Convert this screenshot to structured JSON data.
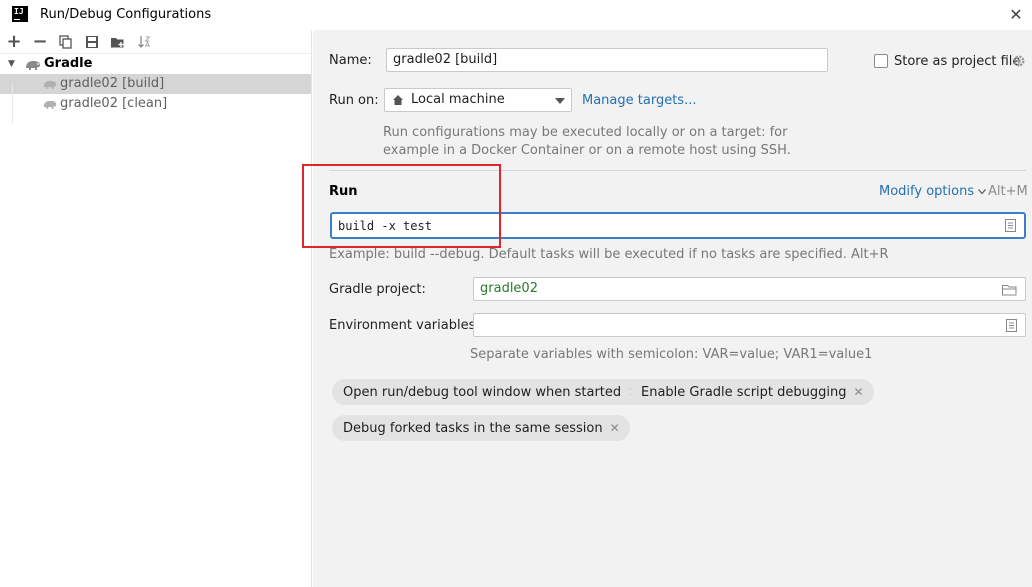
{
  "window": {
    "title": "Run/Debug Configurations",
    "logo_text": "IJ",
    "close_glyph": "✕"
  },
  "toolbar": {
    "add_glyph": "+",
    "remove_glyph": "−"
  },
  "tree": {
    "root": {
      "label": "Gradle",
      "icon": "gradle-elephant-icon"
    },
    "items": [
      {
        "label": "gradle02 [build]",
        "selected": true
      },
      {
        "label": "gradle02 [clean]",
        "selected": false
      }
    ]
  },
  "form": {
    "name_label": "Name:",
    "name_value": "gradle02 [build]",
    "store_as_project_file": "Store as project file",
    "run_on_label": "Run on:",
    "run_on_value": "Local machine",
    "manage_targets": "Manage targets...",
    "run_on_hint_line1": "Run configurations may be executed locally or on a target: for",
    "run_on_hint_line2": "example in a Docker Container or on a remote host using SSH.",
    "run_section": "Run",
    "modify_options": "Modify options",
    "modify_options_shortcut": "Alt+M",
    "tasks_value": "build -x test",
    "tasks_hint": "Example: build --debug. Default tasks will be executed if no tasks are specified. Alt+R",
    "gradle_project_label": "Gradle project:",
    "gradle_project_value": "gradle02",
    "env_vars_label": "Environment variables:",
    "env_vars_value": "",
    "env_vars_hint": "Separate variables with semicolon: VAR=value; VAR1=value1"
  },
  "chips": [
    {
      "label": "Open run/debug tool window when started"
    },
    {
      "label": "Enable Gradle script debugging"
    },
    {
      "label": "Debug forked tasks in the same session"
    }
  ],
  "colors": {
    "accent": "#2470b3",
    "annotation_box": "#e0252b",
    "selection": "#d5d5d5",
    "gradle_value": "#2b7a2b"
  }
}
